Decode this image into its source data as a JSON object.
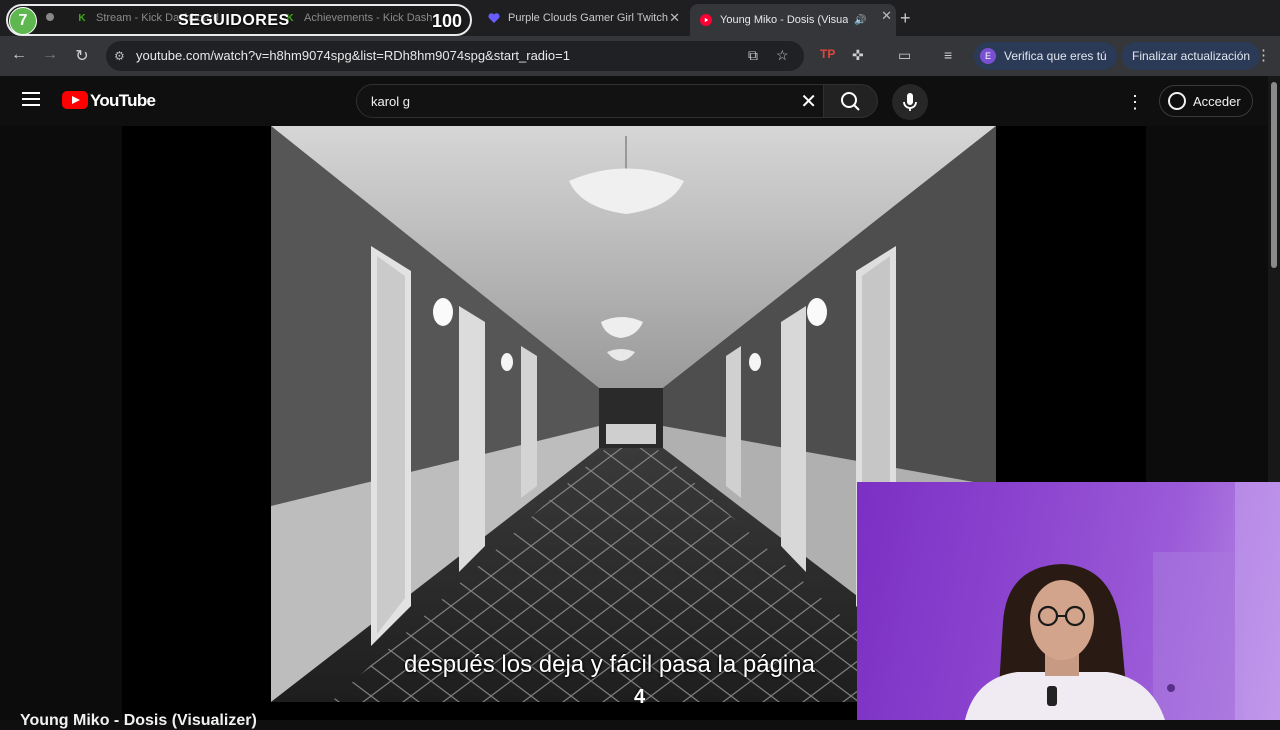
{
  "overlay": {
    "level": "7",
    "label": "SEGUIDORES",
    "count": "100"
  },
  "tabs": [
    {
      "title": "Stream - Kick Dashboard",
      "icon": "kick-icon",
      "color": "#53fc18"
    },
    {
      "title": "Achievements - Kick Dash",
      "icon": "kick-icon",
      "color": "#53fc18"
    },
    {
      "title": "Purple Clouds Gamer Girl Twitch",
      "icon": "heart-icon",
      "color": "#6a5cff"
    },
    {
      "title": "Young Miko - Dosis (Visualizer)",
      "icon": "youtube-icon",
      "color": "#ff0000",
      "active": true
    }
  ],
  "address": {
    "url": "youtube.com/watch?v=h8hm9074spg&list=RDh8hm9074spg&start_radio=1"
  },
  "profile_chip": {
    "initial": "E",
    "label": "Verifica que eres tú"
  },
  "update_chip": {
    "label": "Finalizar actualización"
  },
  "youtube": {
    "logo_text": "YouTube",
    "search_value": "karol g",
    "signin_label": "Acceder"
  },
  "video": {
    "caption": "después los deja y fácil pasa la página",
    "caption_counter": "4",
    "title_peek": "Young Miko - Dosis (Visualizer)"
  },
  "colors": {
    "youtube_red": "#ff0000",
    "webcam_purple": "#8c46cf",
    "level_green": "#5fb84f"
  }
}
